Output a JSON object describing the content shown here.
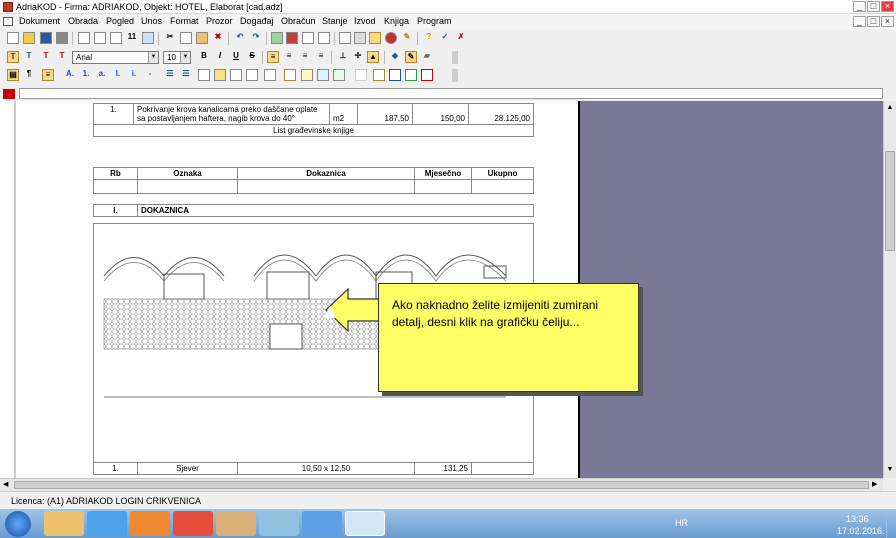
{
  "window": {
    "title": "AdriaKOD - Firma: ADRIAKOD,  Objekt: HOTEL, Elaborat [cad.adz]",
    "minimize": "_",
    "restore": "□",
    "close": "×"
  },
  "menu": [
    "Dokument",
    "Obrada",
    "Pogled",
    "Unos",
    "Format",
    "Prozor",
    "Događaj",
    "Obračun",
    "Stanje",
    "Izvod",
    "Knjiga",
    "Program"
  ],
  "format_toolbar": {
    "font": "Arial",
    "size": "10",
    "styles": [
      "B",
      "I",
      "U",
      "S"
    ]
  },
  "top_row": {
    "rb": "1.",
    "text": "Pokrivanje krova kanalicama preko daščane oplate sa postavljanjem haftera, nagib krova do 40°",
    "unit": "m2",
    "qty": "187,50",
    "price": "150,00",
    "total": "28.125,00"
  },
  "list_label": "List građevinske knjige",
  "columns": [
    "Rb",
    "Oznaka",
    "Dokaznica",
    "Mjesečno",
    "Ukupno"
  ],
  "section": {
    "num": "I.",
    "name": "DOKAZNICA"
  },
  "bottom_row": {
    "rb": "1.",
    "oznaka": "Sjever",
    "dokaznica": "10,50 x 12,50",
    "mjesecno": "131,25"
  },
  "callout_text": "Ako naknadno želite izmijeniti zumirani detalj, desni klik na grafičku čeliju...",
  "status": "Licenca: (A1) ADRIAKOD LOGIN CRIKVENICA",
  "tray": {
    "lang": "HR",
    "time": "13:36",
    "date": "17.02.2016."
  },
  "colors": {
    "accent_red": "#cc0000",
    "gray_pane": "#7a7897",
    "callout": "#ffff66"
  }
}
